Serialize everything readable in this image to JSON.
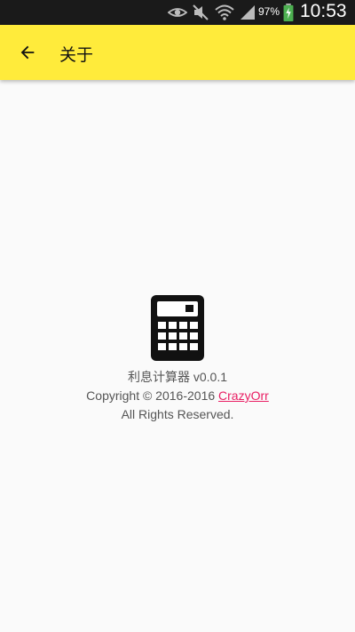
{
  "status_bar": {
    "battery_percent": "97%",
    "time": "10:53",
    "icons": [
      "eye-icon",
      "mute-icon",
      "wifi-icon",
      "signal-icon",
      "battery-charging-icon"
    ]
  },
  "app_bar": {
    "title": "关于",
    "back_icon": "arrow-back-icon",
    "background_color": "#ffeb3b"
  },
  "about": {
    "app_icon": "calculator-icon",
    "app_name_version": "利息计算器  v0.0.1",
    "copyright_prefix": "Copyright © 2016-2016 ",
    "author": "CrazyOrr",
    "rights": "All Rights Reserved.",
    "link_color": "#e91e63"
  }
}
